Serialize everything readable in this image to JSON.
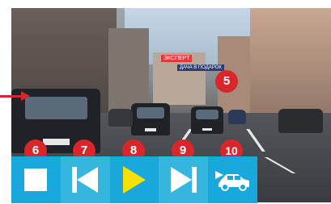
{
  "scene": {
    "signs": {
      "left": "ЭКСПЕРТ",
      "main": "ДАЧА В ПОДАРОК"
    },
    "plates": {
      "left": "В 340 ТО",
      "center": "Е 210 РХ",
      "right": "К 717 КХ"
    }
  },
  "badges": {
    "b5": "5",
    "b6": "6",
    "b7": "7",
    "b8": "8",
    "b9": "9",
    "b10": "10"
  },
  "controls": [
    {
      "name": "stop",
      "icon": "stop-icon"
    },
    {
      "name": "previous",
      "icon": "skip-previous-icon"
    },
    {
      "name": "play",
      "icon": "play-icon"
    },
    {
      "name": "next",
      "icon": "skip-next-icon"
    },
    {
      "name": "camera-toggle",
      "icon": "car-icon"
    }
  ],
  "colors": {
    "badge": "#d8262b",
    "button_dark": "#19a8db",
    "button_light": "#34b6de",
    "play": "#f5e100"
  }
}
